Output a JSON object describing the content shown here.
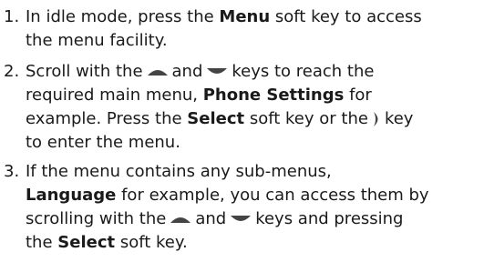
{
  "steps": [
    {
      "number": "1.",
      "lines": [
        {
          "a": "In idle mode, press the ",
          "b": "Menu",
          "c": " soft key to access"
        },
        {
          "a": "the menu facility."
        }
      ]
    },
    {
      "number": "2.",
      "lines": [
        {
          "a": "Scroll with the",
          "b": "and",
          "c": "keys to reach the"
        },
        {
          "a": "required main menu, ",
          "b": "Phone Settings",
          "c": " for"
        },
        {
          "a": "example. Press the ",
          "b": "Select",
          "c": " soft key or the",
          "d": "key"
        },
        {
          "a": "to enter the menu."
        }
      ]
    },
    {
      "number": "3.",
      "lines": [
        {
          "a": "If the menu contains any sub-menus,"
        },
        {
          "b": "Language",
          "c": " for example, you can access them by"
        },
        {
          "a": "scrolling with the",
          "b": "and",
          "c": "keys and pressing"
        },
        {
          "a": "the ",
          "b": "Select",
          "c": " soft key."
        }
      ]
    }
  ],
  "icons": {
    "up": "up-key-icon",
    "down": "down-key-icon",
    "right": "right-key-icon"
  }
}
